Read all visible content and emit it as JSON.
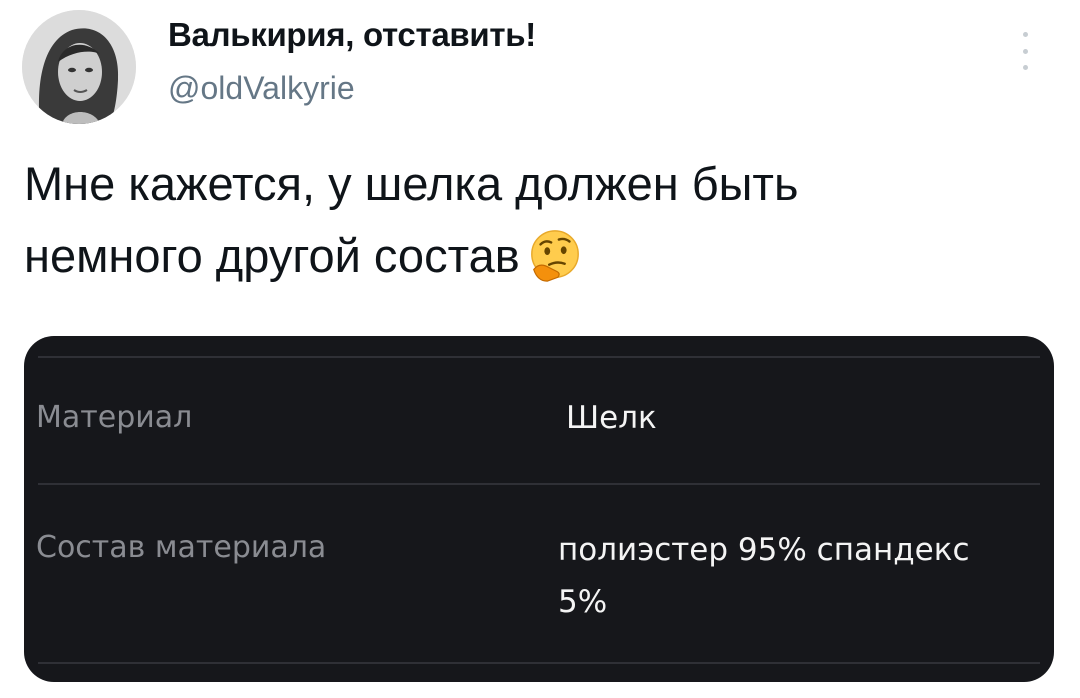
{
  "tweet": {
    "author_name": "Валькирия, отставить!",
    "author_handle": "@oldValkyrie",
    "text_line1": "Мне кажется, у шелка должен быть",
    "text_line2": "немного другой состав",
    "emoji": "thinking-face"
  },
  "product_card": {
    "rows": [
      {
        "label": "Материал",
        "value": "Шелк"
      },
      {
        "label": "Состав материала",
        "value": "полиэстер 95% спандекс 5%"
      }
    ]
  },
  "colors": {
    "card_background": "#16171b",
    "label_gray": "#8a8c92",
    "handle_gray": "#657786"
  }
}
